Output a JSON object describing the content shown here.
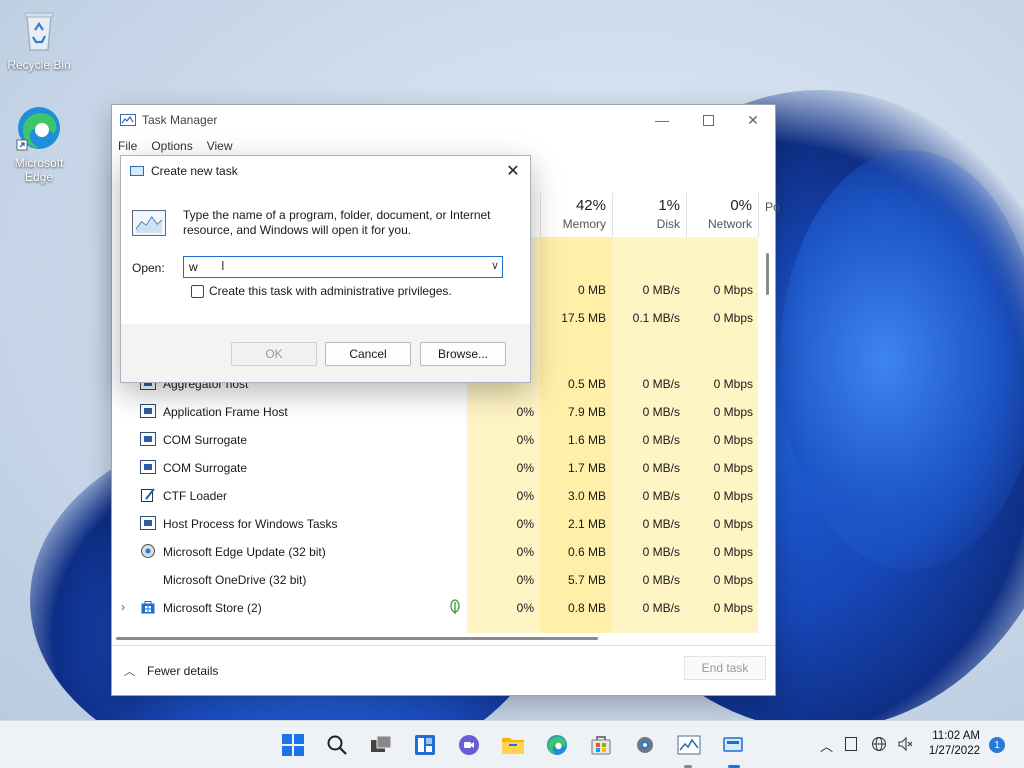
{
  "desktop": {
    "icons": [
      {
        "label": "Recycle Bin"
      },
      {
        "label": "Microsoft Edge"
      }
    ]
  },
  "task_manager": {
    "title": "Task Manager",
    "menu": [
      "File",
      "Options",
      "View"
    ],
    "columns": [
      {
        "pct": "",
        "label": ""
      },
      {
        "pct": "42%",
        "label": "Memory"
      },
      {
        "pct": "1%",
        "label": "Disk"
      },
      {
        "pct": "0%",
        "label": "Network"
      },
      {
        "pct": "",
        "label": "Po"
      }
    ],
    "rows": [
      {
        "name": "",
        "cpu": "",
        "mem": "0 MB",
        "disk": "0 MB/s",
        "net": "0 Mbps"
      },
      {
        "name": "",
        "cpu": "",
        "mem": "17.5 MB",
        "disk": "0.1 MB/s",
        "net": "0 Mbps"
      },
      {
        "name": "Aggregator host",
        "cpu": "",
        "mem": "0.5 MB",
        "disk": "0 MB/s",
        "net": "0 Mbps"
      },
      {
        "name": "Application Frame Host",
        "cpu": "0%",
        "mem": "7.9 MB",
        "disk": "0 MB/s",
        "net": "0 Mbps"
      },
      {
        "name": "COM Surrogate",
        "cpu": "0%",
        "mem": "1.6 MB",
        "disk": "0 MB/s",
        "net": "0 Mbps"
      },
      {
        "name": "COM Surrogate",
        "cpu": "0%",
        "mem": "1.7 MB",
        "disk": "0 MB/s",
        "net": "0 Mbps"
      },
      {
        "name": "CTF Loader",
        "cpu": "0%",
        "mem": "3.0 MB",
        "disk": "0 MB/s",
        "net": "0 Mbps"
      },
      {
        "name": "Host Process for Windows Tasks",
        "cpu": "0%",
        "mem": "2.1 MB",
        "disk": "0 MB/s",
        "net": "0 Mbps"
      },
      {
        "name": "Microsoft Edge Update (32 bit)",
        "cpu": "0%",
        "mem": "0.6 MB",
        "disk": "0 MB/s",
        "net": "0 Mbps"
      },
      {
        "name": "Microsoft OneDrive (32 bit)",
        "cpu": "0%",
        "mem": "5.7 MB",
        "disk": "0 MB/s",
        "net": "0 Mbps"
      },
      {
        "name": "Microsoft Store (2)",
        "cpu": "0%",
        "mem": "0.8 MB",
        "disk": "0 MB/s",
        "net": "0 Mbps"
      }
    ],
    "fewer_details": "Fewer details",
    "end_task": "End task"
  },
  "run_dialog": {
    "title": "Create new task",
    "description": "Type the name of a program, folder, document, or Internet resource, and Windows will open it for you.",
    "open_label": "Open:",
    "open_value": "w",
    "admin_label": "Create this task with administrative privileges.",
    "ok": "OK",
    "cancel": "Cancel",
    "browse": "Browse..."
  },
  "taskbar": {
    "time": "11:02 AM",
    "date": "1/27/2022",
    "notification_count": "1"
  }
}
